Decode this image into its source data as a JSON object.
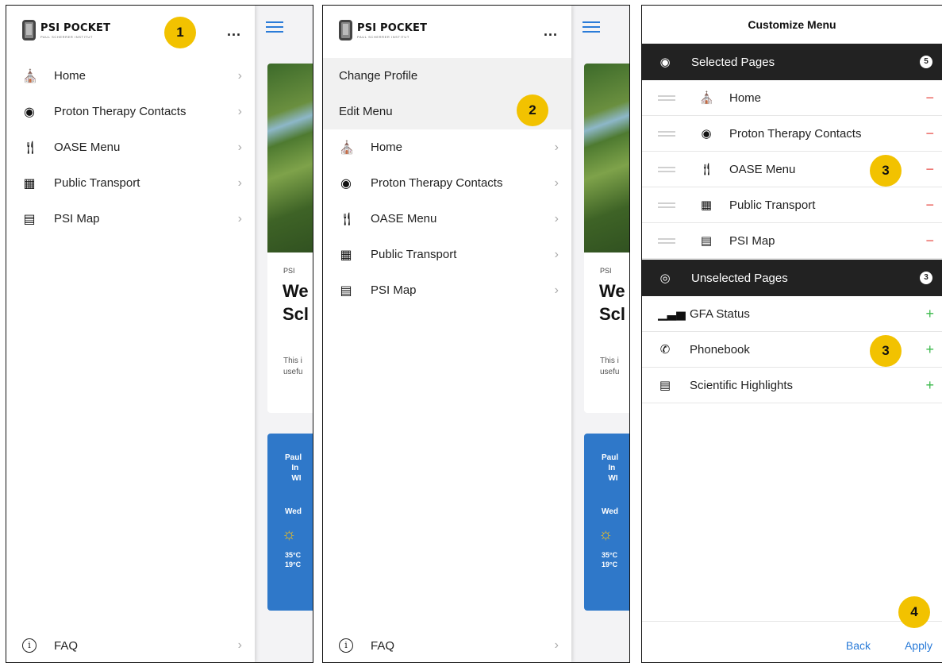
{
  "app": {
    "brand": "PSI POCKET",
    "brand_sub": "PAUL SCHERRER INSTITUT",
    "more": "..."
  },
  "menu": {
    "items": [
      {
        "label": "Home",
        "icon": "home-icon"
      },
      {
        "label": "Proton Therapy Contacts",
        "icon": "contact-icon"
      },
      {
        "label": "OASE Menu",
        "icon": "cutlery-icon"
      },
      {
        "label": "Public Transport",
        "icon": "bus-icon"
      },
      {
        "label": "PSI Map",
        "icon": "map-icon"
      }
    ],
    "faq": "FAQ"
  },
  "profile_menu": {
    "change_profile": "Change Profile",
    "edit_menu": "Edit Menu"
  },
  "page": {
    "tag": "PSI",
    "heading_line1": "We",
    "heading_line2": "Scl",
    "text_line1": "This i",
    "text_line2": "usefu",
    "weather": {
      "title_line1": "Paul",
      "title_line2": "In",
      "title_line3": "WI",
      "day": "Wed",
      "high": "35°C",
      "low": "19°C"
    }
  },
  "badges": {
    "b1": "1",
    "b2": "2",
    "b3a": "3",
    "b3b": "3",
    "b4": "4"
  },
  "customize": {
    "title": "Customize Menu",
    "selected": {
      "label": "Selected Pages",
      "count": "5",
      "items": [
        {
          "label": "Home"
        },
        {
          "label": "Proton Therapy Contacts"
        },
        {
          "label": "OASE Menu"
        },
        {
          "label": "Public Transport"
        },
        {
          "label": "PSI Map"
        }
      ]
    },
    "unselected": {
      "label": "Unselected Pages",
      "count": "3",
      "items": [
        {
          "label": "GFA Status"
        },
        {
          "label": "Phonebook"
        },
        {
          "label": "Scientific Highlights"
        }
      ]
    },
    "back": "Back",
    "apply": "Apply"
  },
  "colors": {
    "accent": "#2a7bd8",
    "badge": "#f2c200",
    "remove": "#e8534e",
    "add": "#3cba4c",
    "header_dark": "#222222"
  }
}
